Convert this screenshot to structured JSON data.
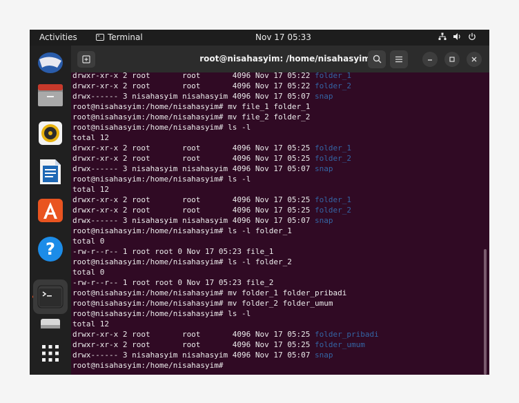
{
  "topbar": {
    "activities": "Activities",
    "app_name": "Terminal",
    "clock": "Nov 17  05:33"
  },
  "dock": {
    "items": [
      {
        "name": "thunderbird"
      },
      {
        "name": "files"
      },
      {
        "name": "rhythmbox"
      },
      {
        "name": "libreoffice-writer"
      },
      {
        "name": "software-center"
      },
      {
        "name": "help"
      },
      {
        "name": "terminal",
        "running": true
      },
      {
        "name": "disk"
      },
      {
        "name": "show-applications"
      }
    ]
  },
  "window": {
    "title": "root@nisahasyim: /home/nisahasyim"
  },
  "terminal": {
    "lines": [
      {
        "text": "drwxr-xr-x 2 root       root       4096 Nov 17 05:22 ",
        "colored": "folder_1",
        "kind": "dir"
      },
      {
        "text": "drwxr-xr-x 2 root       root       4096 Nov 17 05:22 ",
        "colored": "folder_2",
        "kind": "dir"
      },
      {
        "text": "drwx------ 3 nisahasyim nisahasyim 4096 Nov 17 05:07 ",
        "colored": "snap",
        "kind": "snap"
      },
      {
        "text": "root@nisahasyim:/home/nisahasyim# mv file_1 folder_1"
      },
      {
        "text": "root@nisahasyim:/home/nisahasyim# mv file_2 folder_2"
      },
      {
        "text": "root@nisahasyim:/home/nisahasyim# ls -l"
      },
      {
        "text": "total 12"
      },
      {
        "text": "drwxr-xr-x 2 root       root       4096 Nov 17 05:25 ",
        "colored": "folder_1",
        "kind": "dir"
      },
      {
        "text": "drwxr-xr-x 2 root       root       4096 Nov 17 05:25 ",
        "colored": "folder_2",
        "kind": "dir"
      },
      {
        "text": "drwx------ 3 nisahasyim nisahasyim 4096 Nov 17 05:07 ",
        "colored": "snap",
        "kind": "snap"
      },
      {
        "text": "root@nisahasyim:/home/nisahasyim# ls -l"
      },
      {
        "text": "total 12"
      },
      {
        "text": "drwxr-xr-x 2 root       root       4096 Nov 17 05:25 ",
        "colored": "folder_1",
        "kind": "dir"
      },
      {
        "text": "drwxr-xr-x 2 root       root       4096 Nov 17 05:25 ",
        "colored": "folder_2",
        "kind": "dir"
      },
      {
        "text": "drwx------ 3 nisahasyim nisahasyim 4096 Nov 17 05:07 ",
        "colored": "snap",
        "kind": "snap"
      },
      {
        "text": "root@nisahasyim:/home/nisahasyim# ls -l folder_1"
      },
      {
        "text": "total 0"
      },
      {
        "text": "-rw-r--r-- 1 root root 0 Nov 17 05:23 file_1"
      },
      {
        "text": "root@nisahasyim:/home/nisahasyim# ls -l folder_2"
      },
      {
        "text": "total 0"
      },
      {
        "text": "-rw-r--r-- 1 root root 0 Nov 17 05:23 file_2"
      },
      {
        "text": "root@nisahasyim:/home/nisahasyim# mv folder_1 folder_pribadi"
      },
      {
        "text": "root@nisahasyim:/home/nisahasyim# mv folder_2 folder_umum"
      },
      {
        "text": "root@nisahasyim:/home/nisahasyim# ls -l"
      },
      {
        "text": "total 12"
      },
      {
        "text": "drwxr-xr-x 2 root       root       4096 Nov 17 05:25 ",
        "colored": "folder_pribadi",
        "kind": "dir"
      },
      {
        "text": "drwxr-xr-x 2 root       root       4096 Nov 17 05:25 ",
        "colored": "folder_umum",
        "kind": "dir"
      },
      {
        "text": "drwx------ 3 nisahasyim nisahasyim 4096 Nov 17 05:07 ",
        "colored": "snap",
        "kind": "snap"
      },
      {
        "text": "root@nisahasyim:/home/nisahasyim#"
      }
    ]
  },
  "colors": {
    "terminal_bg": "#300a24",
    "dir_blue": "#3465a4",
    "accent_orange": "#e95420"
  }
}
